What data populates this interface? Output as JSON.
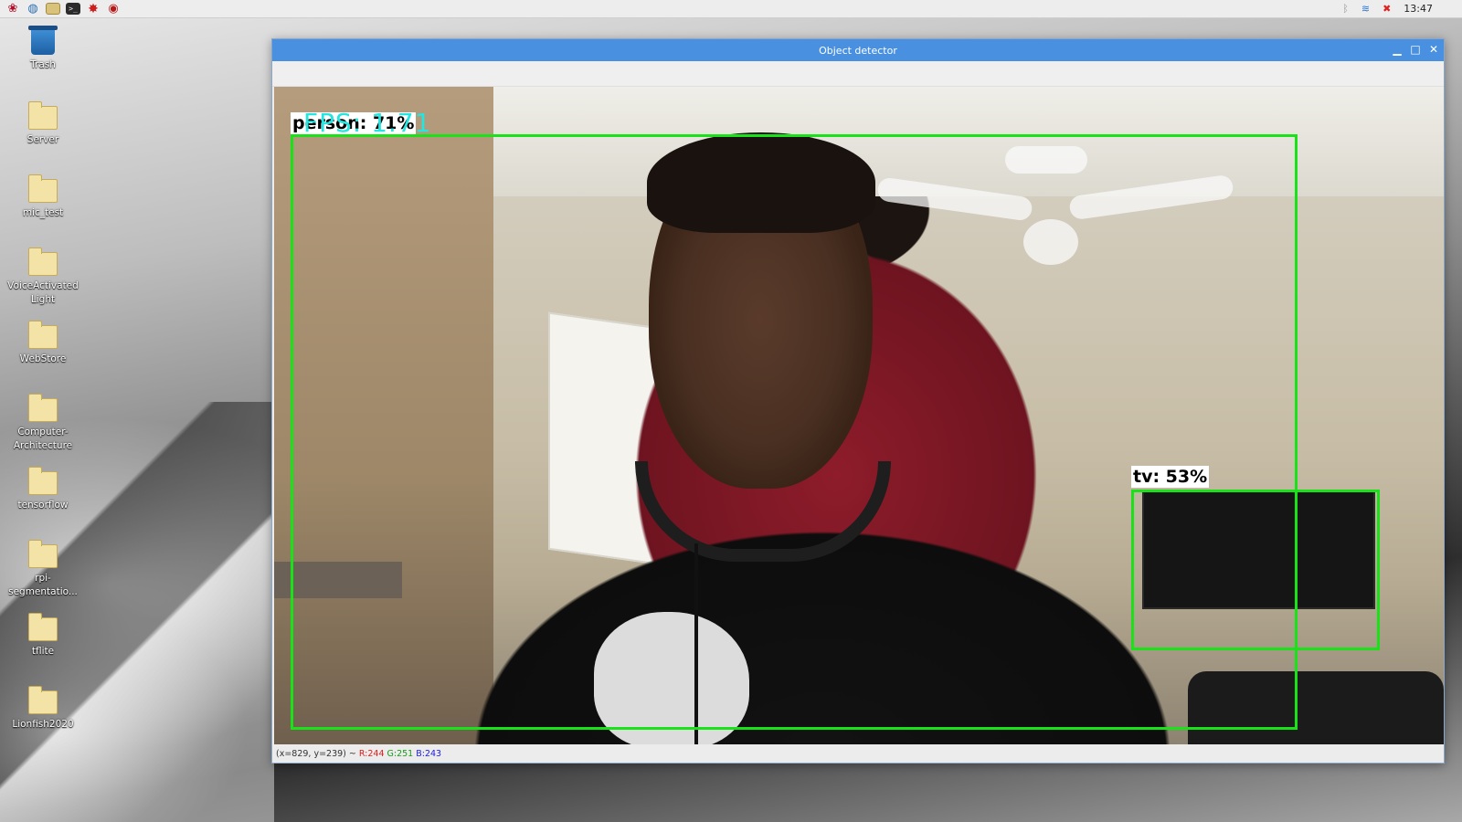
{
  "taskbar": {
    "launchers": [
      {
        "icon": "raspberry-menu-icon",
        "glyph": "❀"
      },
      {
        "icon": "web-browser-icon",
        "glyph": "◍"
      },
      {
        "icon": "file-manager-icon",
        "glyph": ""
      },
      {
        "icon": "terminal-icon",
        "glyph": ">_"
      },
      {
        "icon": "mathematica-icon",
        "glyph": "✸"
      },
      {
        "icon": "wolfram-icon",
        "glyph": "◉"
      }
    ],
    "tray": {
      "bluetooth_glyph": "ᛒ",
      "wifi_glyph": "≋",
      "volume_glyph": "✖",
      "clock": "13:47"
    }
  },
  "desktop": {
    "icons": [
      {
        "label": "Trash",
        "type": "trash"
      },
      {
        "label": "Server",
        "type": "folder"
      },
      {
        "label": "mic_test",
        "type": "folder"
      },
      {
        "label": "VoiceActivated Light",
        "type": "folder"
      },
      {
        "label": "WebStore",
        "type": "folder"
      },
      {
        "label": "Computer-Architecture",
        "type": "folder"
      },
      {
        "label": "tensorflow",
        "type": "folder"
      },
      {
        "label": "rpi-segmentatio...",
        "type": "folder"
      },
      {
        "label": "tflite",
        "type": "folder"
      },
      {
        "label": "Lionfish2020",
        "type": "folder"
      }
    ]
  },
  "window": {
    "title": "Object detector",
    "controls": {
      "minimize": "▁",
      "maximize": "□",
      "close": "✕"
    },
    "overlay": {
      "fps": "FPS: 1.71",
      "detections": [
        {
          "label": "person: 71%",
          "color": "#19e219"
        },
        {
          "label": "tv: 53%",
          "color": "#19e219"
        }
      ]
    },
    "status": {
      "coords": "(x=829, y=239) ~",
      "r": "R:244",
      "g": "G:251",
      "b": "B:243"
    }
  },
  "colors": {
    "titlebar": "#4a90e0",
    "box_green": "#19e219",
    "fps_cyan": "#24e5e0"
  }
}
